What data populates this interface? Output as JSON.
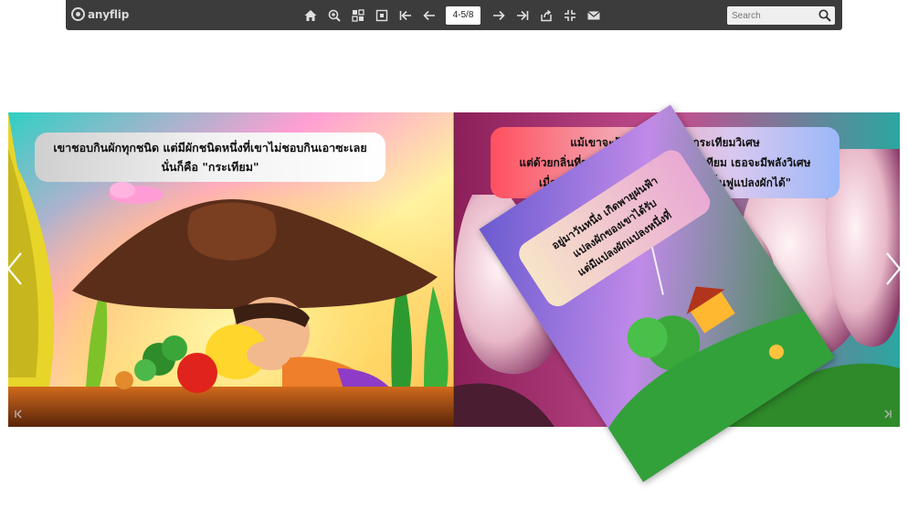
{
  "app": {
    "logo_text": "anyflip"
  },
  "toolbar": {
    "icons": [
      "home-icon",
      "zoom-in-icon",
      "thumbnails-icon",
      "fit-page-icon",
      "first-page-icon",
      "previous-page-icon",
      "next-page-icon",
      "last-page-icon",
      "share-icon",
      "fullscreen-icon",
      "email-icon"
    ],
    "page_indicator": "4-5/8",
    "search_placeholder": "Search"
  },
  "book": {
    "left_page": {
      "text_line1": "เขาชอบกินผักทุกชนิด แต่มีผักชนิดหนึ่งที่เขาไม่ชอบกินเอาซะเลย",
      "text_line2": "นั่นก็คือ \"กระเทียม\""
    },
    "right_page": {
      "text_line1": "แม้เขาจะรู้ว่าผักชนิดนี้ คือกระเทียมวิเศษ",
      "text_line2": "แต่ด้วยกลิ่นที่ชวนปวดหัว เมื่อได้กินกระเทียม เธอจะมีพลังวิเศษ",
      "text_line3": "เมื่อเห็นกระเทียม \"สามารถใช้ในการฟื้นฟูแปลงผักได้\""
    },
    "turning_page": {
      "text_line1": "อยู่มาวันหนึ่ง เกิดพายุฝนฟ้า",
      "text_line2": "แปลงผักของเขาได้รับ",
      "text_line3": "แต่มีแปลงผักแปลงหนึ่งที่"
    }
  },
  "colors": {
    "toolbar_bg": "#3c3c3c",
    "icon_color": "#e0e0e0"
  }
}
